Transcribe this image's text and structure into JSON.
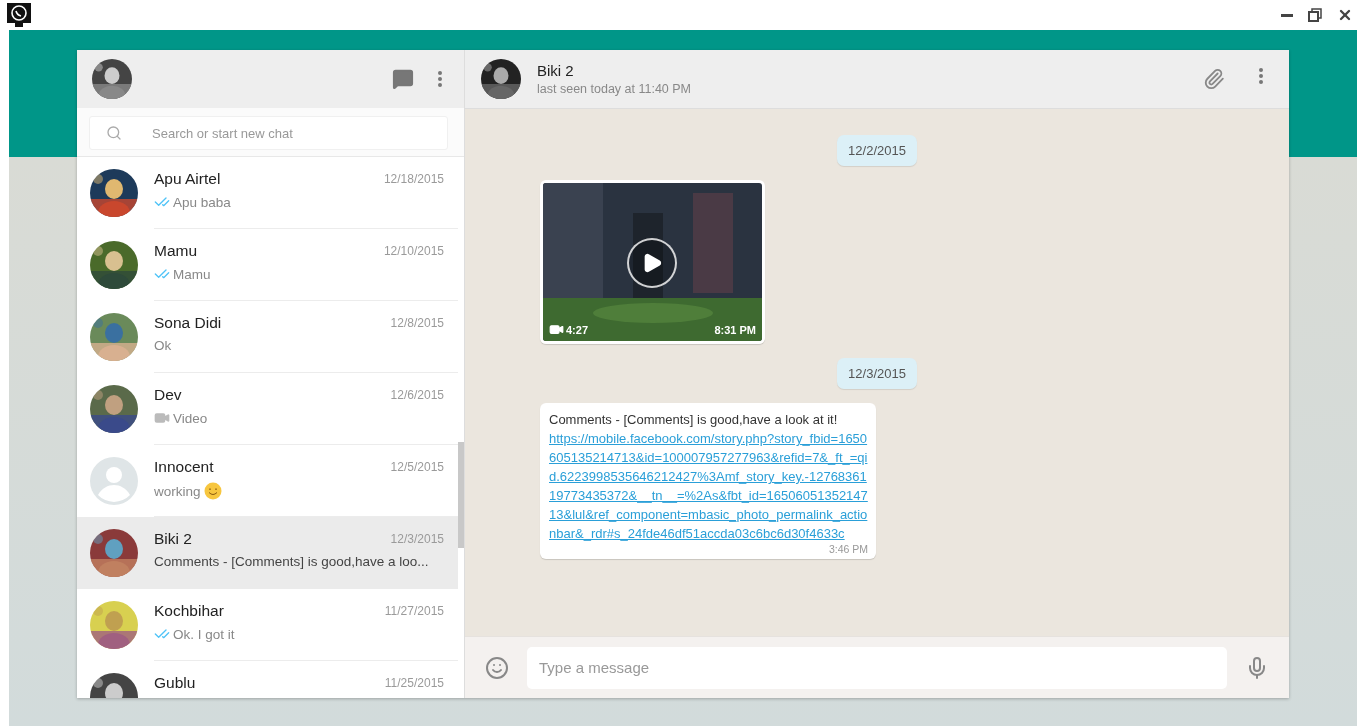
{
  "sidebar": {
    "search": {
      "placeholder": "Search or start new chat"
    },
    "chats": [
      {
        "name": "Apu Airtel",
        "time": "12/18/2015",
        "preview": "Apu baba",
        "video_icon": false,
        "read_ticks": true,
        "emoji": false,
        "default_avatar": false,
        "selected": false
      },
      {
        "name": "Mamu",
        "time": "12/10/2015",
        "preview": "Mamu",
        "video_icon": false,
        "read_ticks": true,
        "emoji": false,
        "default_avatar": false,
        "selected": false
      },
      {
        "name": "Sona Didi",
        "time": "12/8/2015",
        "preview": "Ok",
        "video_icon": false,
        "read_ticks": false,
        "emoji": false,
        "default_avatar": false,
        "selected": false
      },
      {
        "name": "Dev",
        "time": "12/6/2015",
        "preview": "Video",
        "video_icon": true,
        "read_ticks": false,
        "emoji": false,
        "default_avatar": false,
        "selected": false
      },
      {
        "name": "Innocent",
        "time": "12/5/2015",
        "preview": "working",
        "video_icon": false,
        "read_ticks": false,
        "emoji": true,
        "default_avatar": true,
        "selected": false
      },
      {
        "name": "Biki 2",
        "time": "12/3/2015",
        "preview": "Comments - [Comments] is good,have a loo...",
        "video_icon": false,
        "read_ticks": false,
        "emoji": false,
        "default_avatar": false,
        "selected": true
      },
      {
        "name": "Kochbihar",
        "time": "11/27/2015",
        "preview": "Ok. I got it",
        "video_icon": false,
        "read_ticks": true,
        "emoji": false,
        "default_avatar": false,
        "selected": false
      },
      {
        "name": "Gublu",
        "time": "11/25/2015",
        "default_avatar": false,
        "selected": false
      }
    ]
  },
  "chat": {
    "contact": {
      "name": "Biki 2",
      "status": "last seen today at 11:40 PM"
    },
    "messages": [
      {
        "kind": "date",
        "text": "12/2/2015"
      },
      {
        "kind": "video",
        "duration": "4:27",
        "time": "8:31 PM"
      },
      {
        "kind": "date",
        "text": "12/3/2015"
      },
      {
        "kind": "text",
        "text": "Comments - [Comments] is good,have a look at it!",
        "link": "https://mobile.facebook.com/story.php?story_fbid=1650605135214713&id=100007957277963&refid=7&_ft_=qid.6223998535646212427%3Amf_story_key.-1276836119773435372&__tn__=%2As&fbt_id=1650605135214713&lul&ref_component=mbasic_photo_permalink_actionbar&_rdr#s_24fde46df51accda03c6bc6d30f4633c",
        "time": "3:46 PM"
      }
    ],
    "composer": {
      "placeholder": "Type a message"
    }
  }
}
